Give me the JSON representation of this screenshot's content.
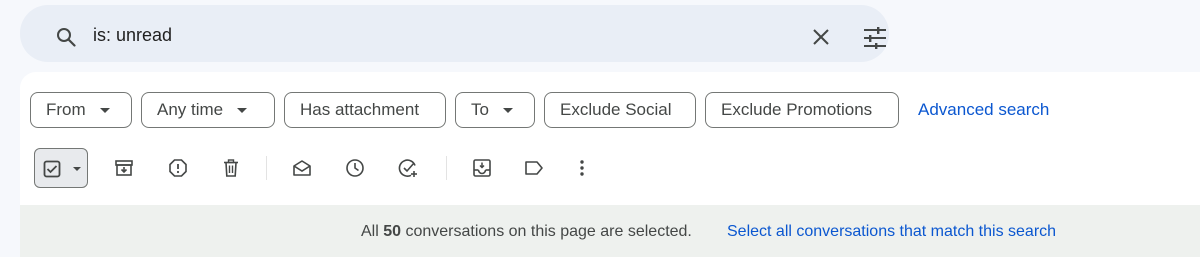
{
  "search": {
    "query": "is: unread"
  },
  "filters": {
    "chips": [
      {
        "label": "From",
        "has_caret": true
      },
      {
        "label": "Any time",
        "has_caret": true
      },
      {
        "label": "Has attachment",
        "has_caret": false
      },
      {
        "label": "To",
        "has_caret": true
      },
      {
        "label": "Exclude Social",
        "has_caret": false
      },
      {
        "label": "Exclude Promotions",
        "has_caret": false
      }
    ],
    "advanced_label": "Advanced search"
  },
  "toolbar": {
    "icons": [
      "select-all-checkbox-icon",
      "archive-icon",
      "report-spam-icon",
      "delete-icon",
      "mark-as-read-icon",
      "snooze-icon",
      "add-to-tasks-icon",
      "move-to-icon",
      "label-icon",
      "more-options-icon"
    ]
  },
  "banner": {
    "prefix": "All ",
    "count": "50",
    "suffix": " conversations on this page are selected.",
    "link": "Select all conversations that match this search"
  },
  "colors": {
    "accent": "#0b57d0",
    "search_bg": "#e9eef6",
    "banner_bg": "#eef1ee"
  }
}
